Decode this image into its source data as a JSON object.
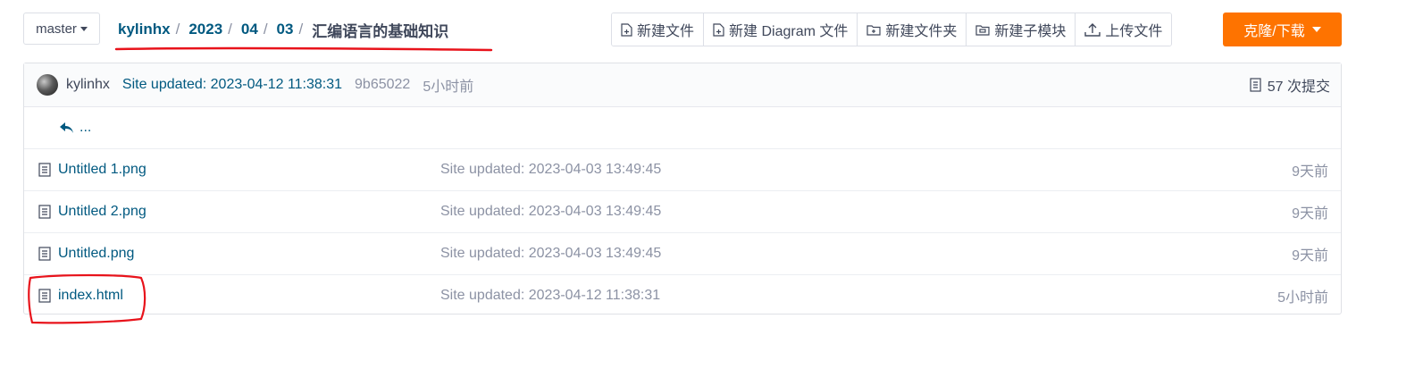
{
  "toolbar": {
    "branch": "master",
    "breadcrumb": {
      "owner": "kylinhx",
      "parts": [
        "2023",
        "04",
        "03"
      ],
      "current": "汇编语言的基础知识",
      "separator": "/"
    },
    "actions": [
      {
        "label": "新建文件",
        "icon": "file-plus-icon"
      },
      {
        "label": "新建 Diagram 文件",
        "icon": "file-plus-icon"
      },
      {
        "label": "新建文件夹",
        "icon": "folder-plus-icon"
      },
      {
        "label": "新建子模块",
        "icon": "folder-link-icon"
      },
      {
        "label": "上传文件",
        "icon": "upload-icon"
      }
    ],
    "clone_label": "克隆/下载"
  },
  "commit": {
    "author": "kylinhx",
    "message": "Site updated: 2023-04-12 11:38:31",
    "sha": "9b65022",
    "time": "5小时前",
    "count_label": "57 次提交"
  },
  "parent_label": "...",
  "files": [
    {
      "name": "Untitled 1.png",
      "message": "Site updated: 2023-04-03 13:49:45",
      "time": "9天前"
    },
    {
      "name": "Untitled 2.png",
      "message": "Site updated: 2023-04-03 13:49:45",
      "time": "9天前"
    },
    {
      "name": "Untitled.png",
      "message": "Site updated: 2023-04-03 13:49:45",
      "time": "9天前"
    },
    {
      "name": "index.html",
      "message": "Site updated: 2023-04-12 11:38:31",
      "time": "5小时前"
    }
  ],
  "colors": {
    "accent": "#fe7300",
    "link": "#005980",
    "annotation": "#e8131b"
  }
}
